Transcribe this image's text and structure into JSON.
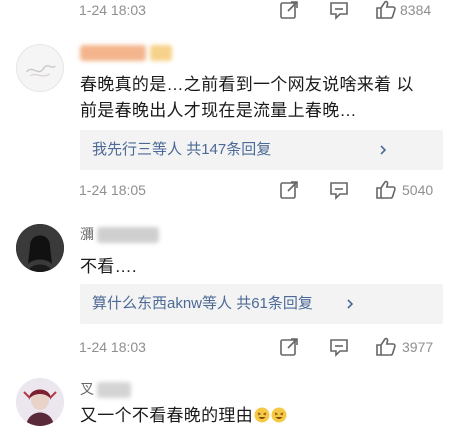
{
  "comments": [
    {
      "time": "1-24 18:03",
      "likes": "8384"
    },
    {
      "content_line1": "春晚真的是…之前看到一个网友说啥来着 以",
      "content_line2": "前是春晚出人才现在是流量上春晚…",
      "reply_names": "我先行三等人",
      "reply_count": "共147条回复",
      "time": "1-24 18:05",
      "likes": "5040"
    },
    {
      "username": "瀰",
      "content": "不看….",
      "reply_names": "算什么东西aknw等人",
      "reply_count": "共61条回复",
      "time": "1-24 18:03",
      "likes": "3977"
    },
    {
      "username": "叉",
      "content": "又一个不看春晚的理由"
    }
  ],
  "icons": {
    "forward": "share-square-icon",
    "comment": "comment-icon",
    "like": "thumbs-up-icon",
    "reply_more": "chevron-right-icon"
  },
  "colors": {
    "link": "#4c6a97",
    "meta": "#8f8f8f",
    "reply_bg": "#f3f3f3"
  }
}
